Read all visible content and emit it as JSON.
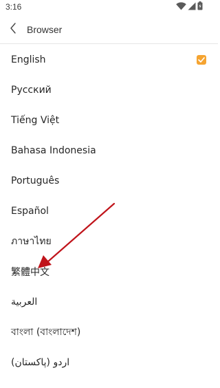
{
  "status_bar": {
    "time": "3:16",
    "icons": [
      "wifi-icon",
      "cell-signal-icon",
      "battery-icon"
    ]
  },
  "header": {
    "back_icon": "chevron-left-icon",
    "title": "Browser"
  },
  "languages": [
    {
      "label": "English",
      "selected": true
    },
    {
      "label": "Русский",
      "selected": false
    },
    {
      "label": "Tiếng Việt",
      "selected": false
    },
    {
      "label": "Bahasa Indonesia",
      "selected": false
    },
    {
      "label": "Português",
      "selected": false
    },
    {
      "label": "Español",
      "selected": false
    },
    {
      "label": "ภาษาไทย",
      "selected": false
    },
    {
      "label": "繁體中文",
      "selected": false
    },
    {
      "label": "العربية",
      "selected": false
    },
    {
      "label": "বাংলা (বাংলাদেশ)",
      "selected": false
    },
    {
      "label": "اردو (پاکستان)",
      "selected": false
    }
  ],
  "colors": {
    "accent": "#f5a431",
    "annotation_arrow": "#c0141b",
    "divider": "#e6e6e6"
  }
}
